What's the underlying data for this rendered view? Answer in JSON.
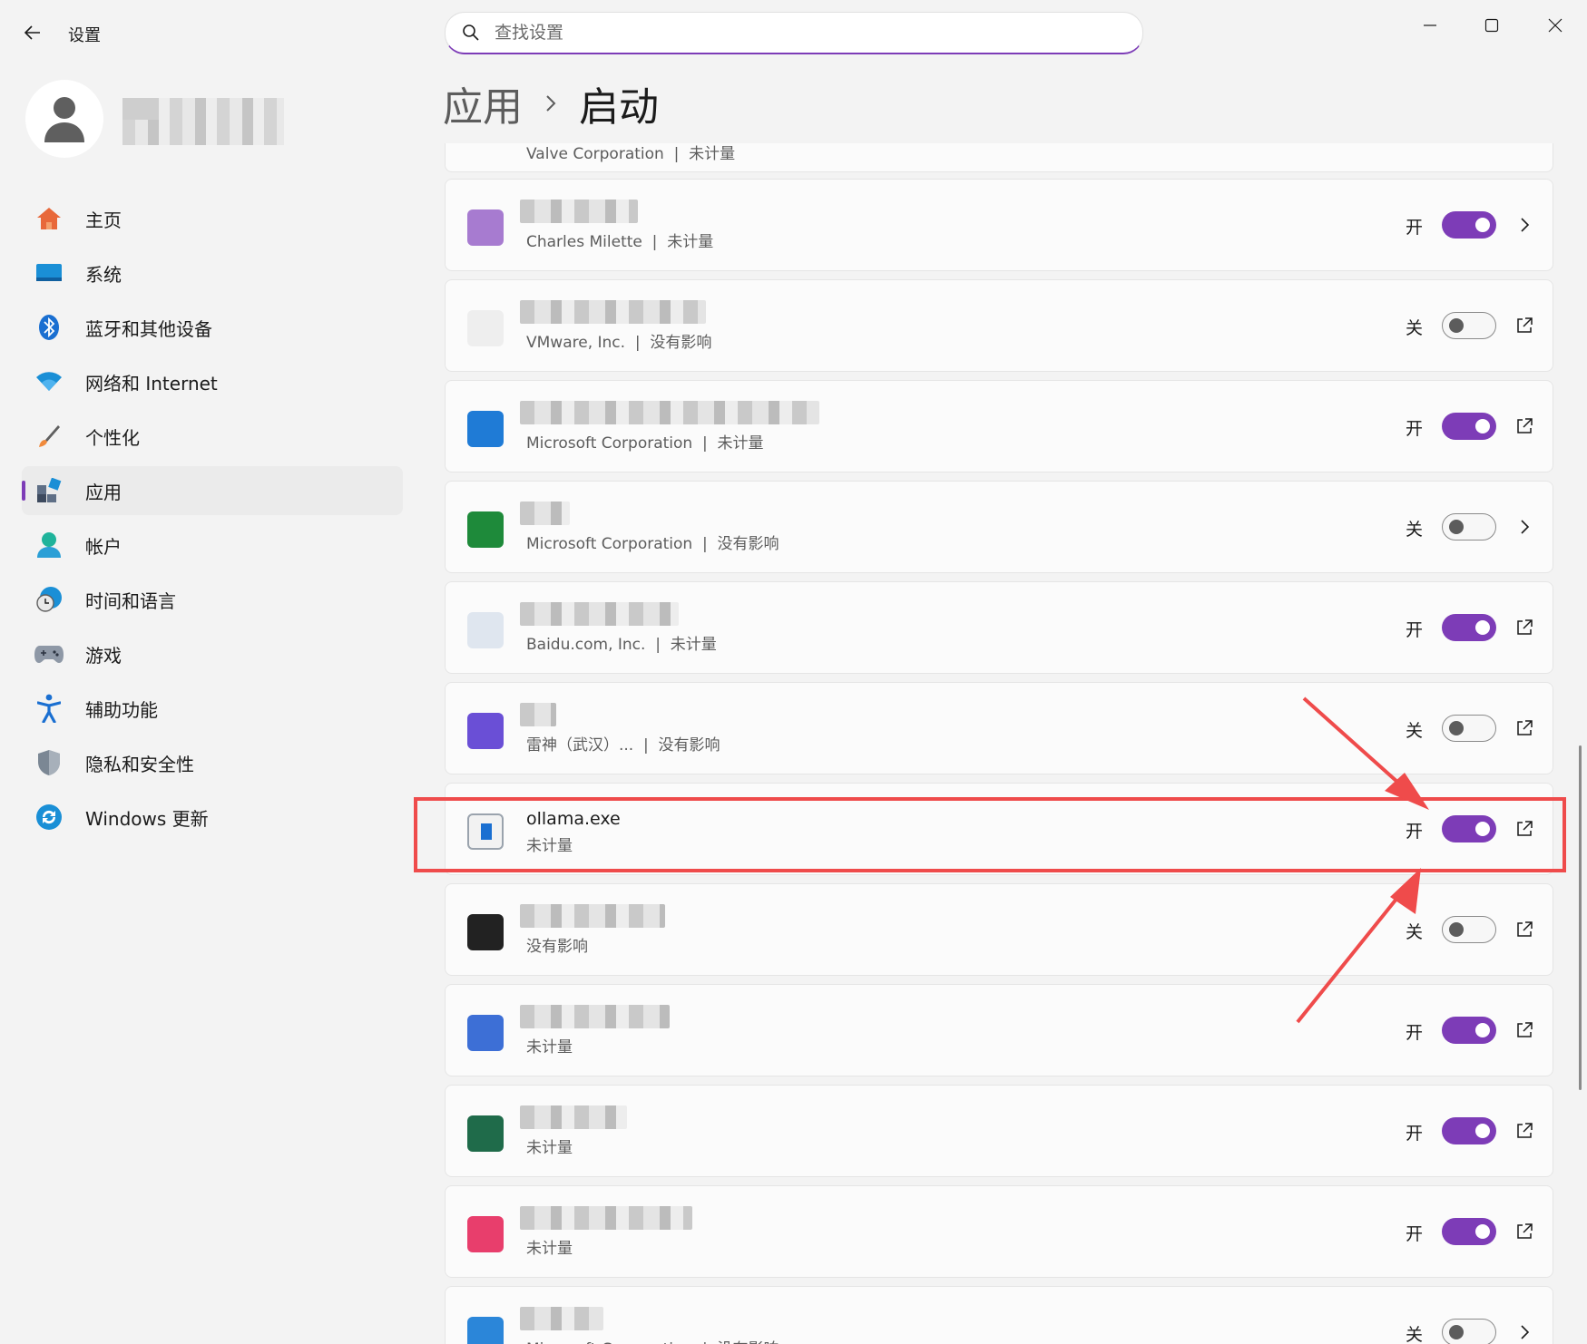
{
  "window": {
    "title": "设置",
    "controls": [
      "minimize",
      "maximize",
      "close"
    ]
  },
  "search": {
    "placeholder": "查找设置",
    "value": ""
  },
  "sidebar": {
    "items": [
      {
        "label": "主页",
        "icon": "home-icon"
      },
      {
        "label": "系统",
        "icon": "system-icon"
      },
      {
        "label": "蓝牙和其他设备",
        "icon": "bluetooth-icon"
      },
      {
        "label": "网络和 Internet",
        "icon": "wifi-icon"
      },
      {
        "label": "个性化",
        "icon": "brush-icon"
      },
      {
        "label": "应用",
        "icon": "apps-icon",
        "active": true
      },
      {
        "label": "帐户",
        "icon": "account-icon"
      },
      {
        "label": "时间和语言",
        "icon": "clock-globe-icon"
      },
      {
        "label": "游戏",
        "icon": "gamepad-icon"
      },
      {
        "label": "辅助功能",
        "icon": "accessibility-icon"
      },
      {
        "label": "隐私和安全性",
        "icon": "shield-icon"
      },
      {
        "label": "Windows 更新",
        "icon": "update-icon"
      }
    ]
  },
  "breadcrumb": {
    "parent": "应用",
    "current": "启动"
  },
  "startup_apps": [
    {
      "name": "",
      "subtitle": "Valve Corporation  |  未计量",
      "state": "on",
      "action": "chevron"
    },
    {
      "name": "",
      "subtitle": "Charles Milette  |  未计量",
      "state": "on",
      "action": "chevron",
      "icon_color": "#a77bd0"
    },
    {
      "name": "",
      "subtitle": "VMware, Inc.  |  没有影响",
      "state": "off",
      "action": "external",
      "icon_color": "#eeeeee"
    },
    {
      "name": "",
      "subtitle": "Microsoft Corporation  |  未计量",
      "state": "on",
      "action": "external",
      "icon_color": "#1f7bd6"
    },
    {
      "name": "",
      "subtitle": "Microsoft Corporation  |  没有影响",
      "state": "off",
      "action": "chevron",
      "icon_color": "#1e8a3a"
    },
    {
      "name": "",
      "subtitle": "Baidu.com, Inc.  |  未计量",
      "state": "on",
      "action": "external",
      "icon_color": "#dfe6ef"
    },
    {
      "name": "",
      "subtitle": "雷神（武汉）...  |  没有影响",
      "state": "off",
      "action": "external",
      "icon_color": "#6a4fd6"
    },
    {
      "name": "ollama.exe",
      "subtitle": "未计量",
      "state": "on",
      "action": "external",
      "icon_color": "#1a6fd1",
      "highlighted": true
    },
    {
      "name": "",
      "subtitle": "没有影响",
      "state": "off",
      "action": "external",
      "icon_color": "#222222"
    },
    {
      "name": "",
      "subtitle": "未计量",
      "state": "on",
      "action": "external",
      "icon_color": "#3d6fd6"
    },
    {
      "name": "",
      "subtitle": "未计量",
      "state": "on",
      "action": "external",
      "icon_color": "#1f6b4a"
    },
    {
      "name": "",
      "subtitle": "未计量",
      "state": "on",
      "action": "external",
      "icon_color": "#e83e6c"
    },
    {
      "name": "",
      "subtitle": "Microsoft Corporation  |  没有影响",
      "state": "off",
      "action": "chevron",
      "icon_color": "#2b86d9"
    }
  ],
  "state_labels": {
    "on": "开",
    "off": "关"
  },
  "colors": {
    "accent": "#7d3cb7",
    "annotation": "#ef4b4b"
  }
}
